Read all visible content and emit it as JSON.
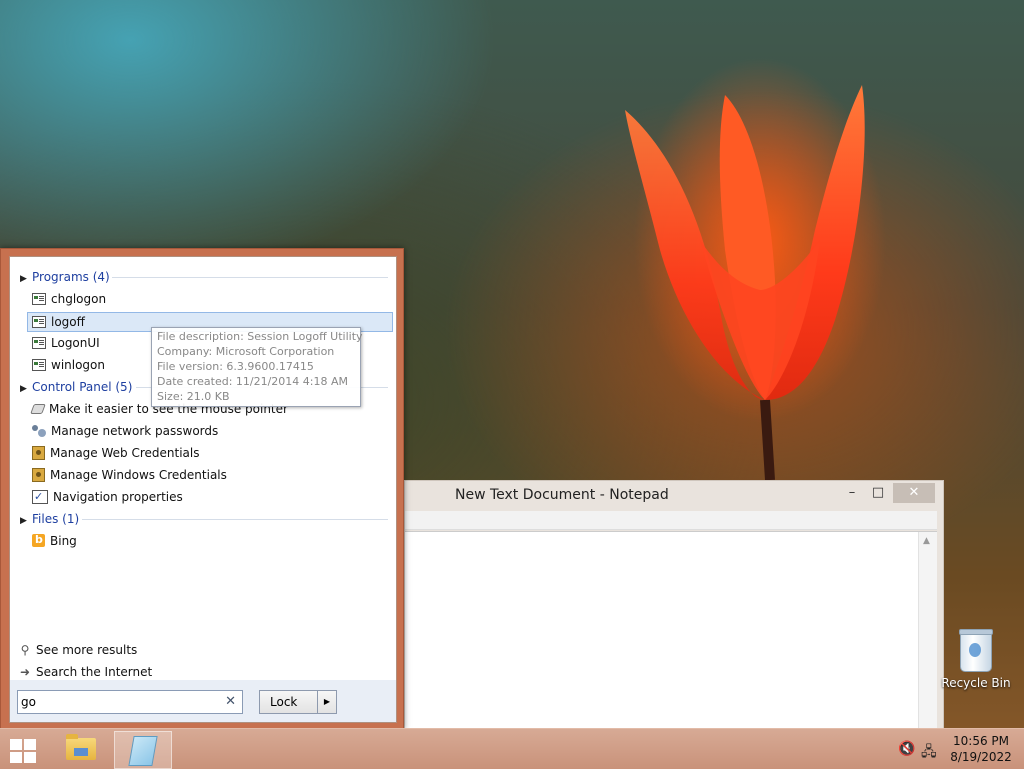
{
  "start_search": {
    "groups": [
      {
        "header": "Programs (4)",
        "items": [
          "chglogon",
          "logoff",
          "LogonUI",
          "winlogon"
        ]
      },
      {
        "header": "Control Panel (5)",
        "items": [
          "Make it easier to see the mouse pointer",
          "Manage network passwords",
          "Manage Web Credentials",
          "Manage Windows Credentials",
          "Navigation properties"
        ]
      },
      {
        "header": "Files (1)",
        "items": [
          "Bing"
        ]
      }
    ],
    "see_more": "See more results",
    "search_internet": "Search the Internet",
    "search_value": "go",
    "power_button_label": "Lock"
  },
  "tooltip": {
    "line1": "File description: Session Logoff Utility",
    "line2": "Company: Microsoft Corporation",
    "line3": "File version: 6.3.9600.17415",
    "line4": "Date created: 11/21/2014 4:18 AM",
    "line5": "Size: 21.0 KB"
  },
  "notepad": {
    "title": "New Text Document - Notepad",
    "minimize": "–",
    "maximize": "□",
    "close": "✕"
  },
  "desktop": {
    "recycle_bin_label": "Recycle Bin"
  },
  "taskbar": {
    "time": "10:56 PM",
    "date": "8/19/2022"
  },
  "colors": {
    "start_panel_border": "#c7714f",
    "taskbar": "#c9927a",
    "group_header_text": "#1e3fa0",
    "selection": "#dbe8f7"
  }
}
